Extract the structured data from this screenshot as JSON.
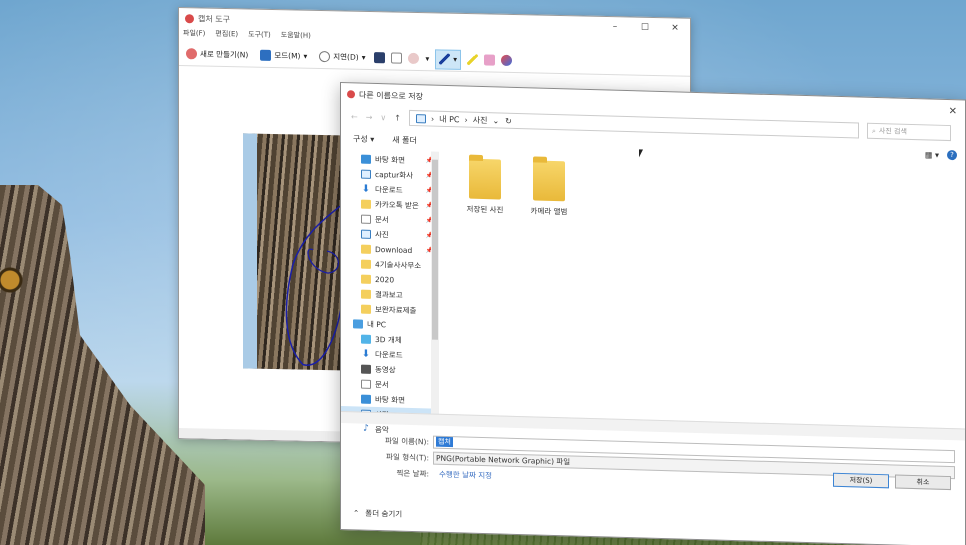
{
  "snip": {
    "title": "캡처 도구",
    "menu": [
      "파일(F)",
      "편집(E)",
      "도구(T)",
      "도움말(H)"
    ],
    "new_label": "새로 만들기(N)",
    "mode_label": "모드(M)",
    "delay_label": "지연(D)",
    "title_controls": [
      "–",
      "☐",
      "✕"
    ]
  },
  "dialog": {
    "title": "다른 이름으로 저장",
    "nav_arrows": [
      "←",
      "→",
      "∨",
      "↑"
    ],
    "breadcrumb": [
      "내 PC",
      "사진"
    ],
    "search_placeholder": "사진 검색",
    "organize": "구성 ▾",
    "new_folder": "새 폴더",
    "close_glyph": "✕",
    "view_glyph": "▦ ▾",
    "help_glyph": "?",
    "refresh_glyph": "↻",
    "dropdown_glyph": "⌄",
    "quick_access": [
      {
        "label": "바탕 화면",
        "icon": "desktop-icon",
        "pinned": true
      },
      {
        "label": "captur화사",
        "icon": "picture-icon",
        "pinned": true
      },
      {
        "label": "다운로드",
        "icon": "download-icon",
        "pinned": true
      },
      {
        "label": "카카오톡 받은",
        "icon": "folder-icon",
        "pinned": true
      },
      {
        "label": "문서",
        "icon": "document-icon",
        "pinned": true
      },
      {
        "label": "사진",
        "icon": "picture-icon",
        "pinned": true
      },
      {
        "label": "Download",
        "icon": "folder-icon",
        "pinned": true
      },
      {
        "label": "4기술사사무소",
        "icon": "folder-icon",
        "pinned": false
      },
      {
        "label": "2020",
        "icon": "folder-icon",
        "pinned": false
      },
      {
        "label": "결과보고",
        "icon": "folder-icon",
        "pinned": false
      },
      {
        "label": "보완자료제출",
        "icon": "folder-icon",
        "pinned": false
      }
    ],
    "this_pc_label": "내 PC",
    "this_pc_items": [
      {
        "label": "3D 개체",
        "icon": "cube-icon"
      },
      {
        "label": "다운로드",
        "icon": "download-icon"
      },
      {
        "label": "동영상",
        "icon": "video-icon"
      },
      {
        "label": "문서",
        "icon": "document-icon"
      },
      {
        "label": "바탕 화면",
        "icon": "desktop-icon"
      },
      {
        "label": "사진",
        "icon": "picture-icon",
        "selected": true
      },
      {
        "label": "음악",
        "icon": "music-icon"
      }
    ],
    "folders": [
      "저장된 사진",
      "카메라 앨범"
    ],
    "filename_label": "파일 이름(N):",
    "filename_value": "캡처",
    "filetype_label": "파일 형식(T):",
    "filetype_value": "PNG(Portable Network Graphic) 파일",
    "date_label": "찍은 날짜:",
    "date_value": "수행한 날짜 지정",
    "save_button": "저장(S)",
    "cancel_button": "취소",
    "hide_folders": "폴더 숨기기"
  }
}
